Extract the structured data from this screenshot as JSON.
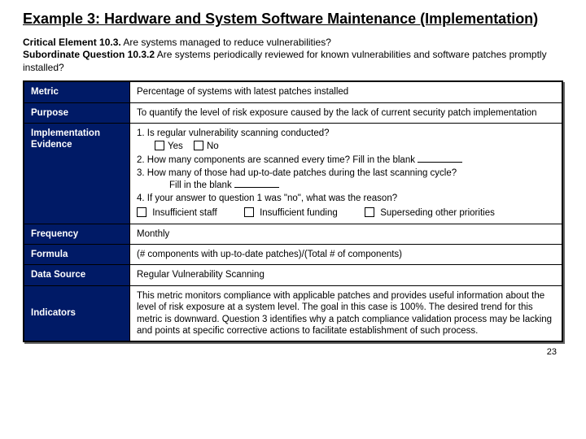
{
  "title": "Example 3: Hardware and System Software Maintenance (Implementation)",
  "critical": {
    "label": "Critical Element 10.3.",
    "text": " Are systems managed to reduce vulnerabilities?"
  },
  "subq": {
    "label": "Subordinate Question 10.3.2",
    "text": "  Are systems periodically reviewed for known vulnerabilities and software patches promptly installed?"
  },
  "rows": {
    "metric": {
      "label": "Metric",
      "value": "Percentage of systems with latest patches installed"
    },
    "purpose": {
      "label": "Purpose",
      "value": "To quantify the level of risk exposure caused by the lack of current security patch implementation"
    },
    "evidence": {
      "label": "Implementation Evidence",
      "q1": "1.  Is regular vulnerability scanning conducted?",
      "yes": "Yes",
      "no": "No",
      "q2": "2.  How many components are scanned every time? Fill in the blank ",
      "q3": "3.  How many of those had up-to-date patches during the last scanning cycle?",
      "q3fill": "Fill in the blank ",
      "q4": "4. If your answer to question 1 was \"no\", what was the reason?",
      "opt1": "Insufficient staff",
      "opt2": "Insufficient funding",
      "opt3": "Superseding other priorities"
    },
    "frequency": {
      "label": "Frequency",
      "value": "Monthly"
    },
    "formula": {
      "label": "Formula",
      "value": "(# components with up-to-date patches)/(Total # of components)"
    },
    "datasource": {
      "label": "Data Source",
      "value": "Regular Vulnerability Scanning"
    },
    "indicators": {
      "label": "Indicators",
      "value": "This metric monitors compliance with applicable patches and provides useful information about the level of risk exposure at a system level. The goal in this case is 100%. The desired trend for this metric is downward.  Question 3 identifies why a patch compliance validation process may be lacking and points at specific corrective actions to facilitate establishment of such process."
    }
  },
  "pagenum": "23"
}
